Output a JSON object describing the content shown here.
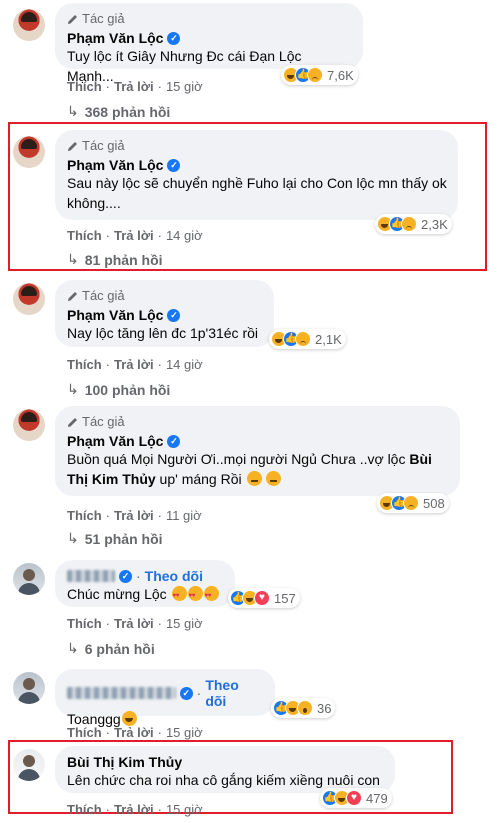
{
  "labels": {
    "author": "Tác giả",
    "like": "Thích",
    "reply": "Trả lời",
    "follow": "Theo dõi",
    "dot": "·"
  },
  "comments": [
    {
      "name": "Phạm Văn Lộc",
      "text": "Tuy lộc ít Giây Nhưng Đc cái Đạn Lộc Mạnh...",
      "time": "15 giờ",
      "reactions": [
        "haha",
        "like",
        "sad"
      ],
      "reaction_count": "7,6K",
      "replies": "368 phản hồi"
    },
    {
      "name": "Phạm Văn Lộc",
      "text": "Sau này lộc sẽ chuyển nghề Fuho lại cho Con lộc mn thấy ok không....",
      "time": "14 giờ",
      "reactions": [
        "haha",
        "like",
        "sad"
      ],
      "reaction_count": "2,3K",
      "replies": "81 phản hồi"
    },
    {
      "name": "Phạm Văn Lộc",
      "text": "Nay lộc tăng lên đc 1p'31éc rồi",
      "time": "14 giờ",
      "reactions": [
        "haha",
        "like",
        "sad"
      ],
      "reaction_count": "2,1K",
      "replies": "100 phản hồi"
    },
    {
      "name": "Phạm Văn Lộc",
      "text_before": "Buồn quá Mọi Người Ơi..mọi người Ngủ Chưa ..vợ lộc ",
      "text_bold": "Bùi Thị Kim Thủy",
      "text_after": " up' máng Rồi",
      "time": "11 giờ",
      "reactions": [
        "haha",
        "like",
        "sad"
      ],
      "reaction_count": "508",
      "replies": "51 phản hồi"
    },
    {
      "text": "Chúc mừng Lộc",
      "time": "15 giờ",
      "reactions": [
        "like",
        "haha",
        "love"
      ],
      "reaction_count": "157",
      "replies": "6 phản hồi"
    },
    {
      "text": "Toanggg",
      "time": "15 giờ",
      "reactions": [
        "like",
        "haha",
        "wow"
      ],
      "reaction_count": "36"
    },
    {
      "name": "Bùi Thị Kim Thủy",
      "text": "Lên chức cha roi nha cô gắng kiếm xiềng nuôi con",
      "time": "15 giờ",
      "reactions": [
        "like",
        "haha",
        "love"
      ],
      "reaction_count": "479"
    }
  ],
  "colors": {
    "highlight": "#e11d2c",
    "link": "#216fdb",
    "bubble": "#f0f2f5"
  }
}
